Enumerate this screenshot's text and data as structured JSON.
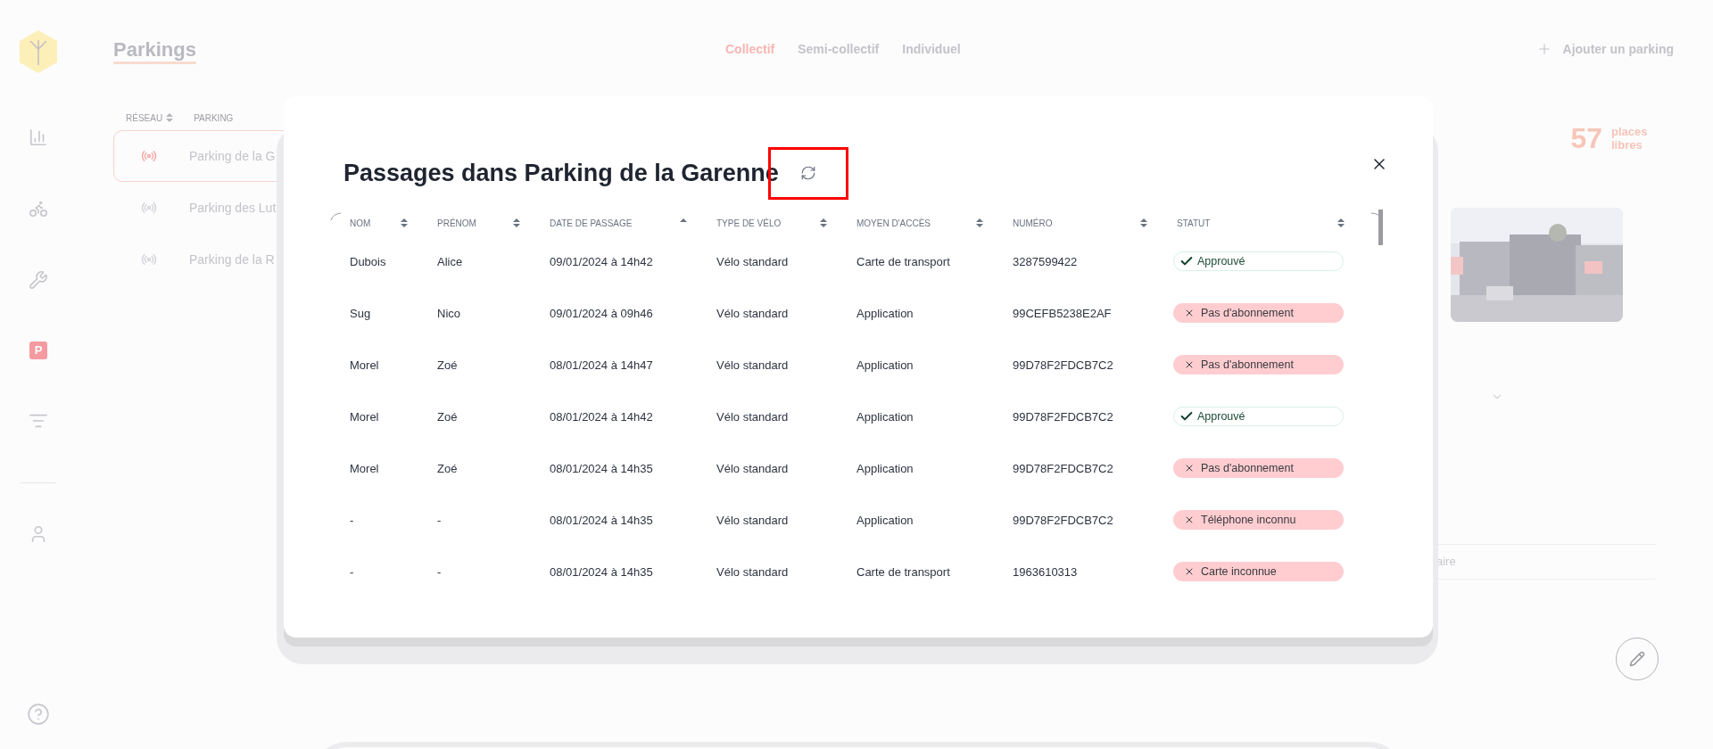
{
  "sidebar": {
    "items": [
      {
        "kind": "stats",
        "selected": false
      },
      {
        "kind": "bikes",
        "selected": false
      },
      {
        "kind": "maintenance",
        "selected": false
      },
      {
        "kind": "parkings",
        "label": "P",
        "selected": true
      },
      {
        "kind": "settings",
        "selected": false
      },
      {
        "kind": "account",
        "selected": false
      }
    ]
  },
  "header": {
    "title": "Parkings",
    "tabs": [
      {
        "label": "Collectif",
        "selected": true
      },
      {
        "label": "Semi-collectif",
        "selected": false
      },
      {
        "label": "Individuel",
        "selected": false
      }
    ],
    "add_button": "Ajouter un parking"
  },
  "parking_list": {
    "columns": [
      "RÉSEAU",
      "PARKING"
    ],
    "rows": [
      {
        "name": "Parking de la G",
        "selected": true
      },
      {
        "name": "Parking des Lut",
        "selected": false
      },
      {
        "name": "Parking de la R",
        "selected": false
      }
    ]
  },
  "availability": {
    "count": "57",
    "label": "places libres"
  },
  "details": {
    "comment_fragment": "aire"
  },
  "modal": {
    "title": "Passages dans Parking de la Garenne",
    "columns": [
      {
        "label": "NOM",
        "sorted": false
      },
      {
        "label": "PRÉNOM",
        "sorted": false
      },
      {
        "label": "DATE DE PASSAGE",
        "sorted": true
      },
      {
        "label": "TYPE DE VÉLO",
        "sorted": false
      },
      {
        "label": "MOYEN D'ACCÈS",
        "sorted": false
      },
      {
        "label": "NUMÉRO",
        "sorted": false
      },
      {
        "label": "STATUT",
        "sorted": false
      }
    ],
    "rows": [
      {
        "cells": [
          "Dubois",
          "Alice",
          "09/01/2024 à 14h42",
          "Vélo standard",
          "Carte de transport",
          "3287599422"
        ],
        "status": {
          "kind": "approved",
          "label": "Approuvé"
        }
      },
      {
        "cells": [
          "Sug",
          "Nico",
          "09/01/2024 à 09h46",
          "Vélo standard",
          "Application",
          "99CEFB5238E2AF"
        ],
        "status": {
          "kind": "rejected",
          "label": "Pas d'abonnement"
        }
      },
      {
        "cells": [
          "Morel",
          "Zoé",
          "08/01/2024 à 14h47",
          "Vélo standard",
          "Application",
          "99D78F2FDCB7C2"
        ],
        "status": {
          "kind": "rejected",
          "label": "Pas d'abonnement"
        }
      },
      {
        "cells": [
          "Morel",
          "Zoé",
          "08/01/2024 à 14h42",
          "Vélo standard",
          "Application",
          "99D78F2FDCB7C2"
        ],
        "status": {
          "kind": "approved",
          "label": "Approuvé"
        }
      },
      {
        "cells": [
          "Morel",
          "Zoé",
          "08/01/2024 à 14h35",
          "Vélo standard",
          "Application",
          "99D78F2FDCB7C2"
        ],
        "status": {
          "kind": "rejected",
          "label": "Pas d'abonnement"
        }
      },
      {
        "cells": [
          "-",
          "-",
          "08/01/2024 à 14h35",
          "Vélo standard",
          "Application",
          "99D78F2FDCB7C2"
        ],
        "status": {
          "kind": "rejected",
          "label": "Téléphone inconnu"
        }
      },
      {
        "cells": [
          "-",
          "-",
          "08/01/2024 à 14h35",
          "Vélo standard",
          "Carte de transport",
          "1963610313"
        ],
        "status": {
          "kind": "rejected",
          "label": "Carte inconnue"
        }
      }
    ]
  }
}
